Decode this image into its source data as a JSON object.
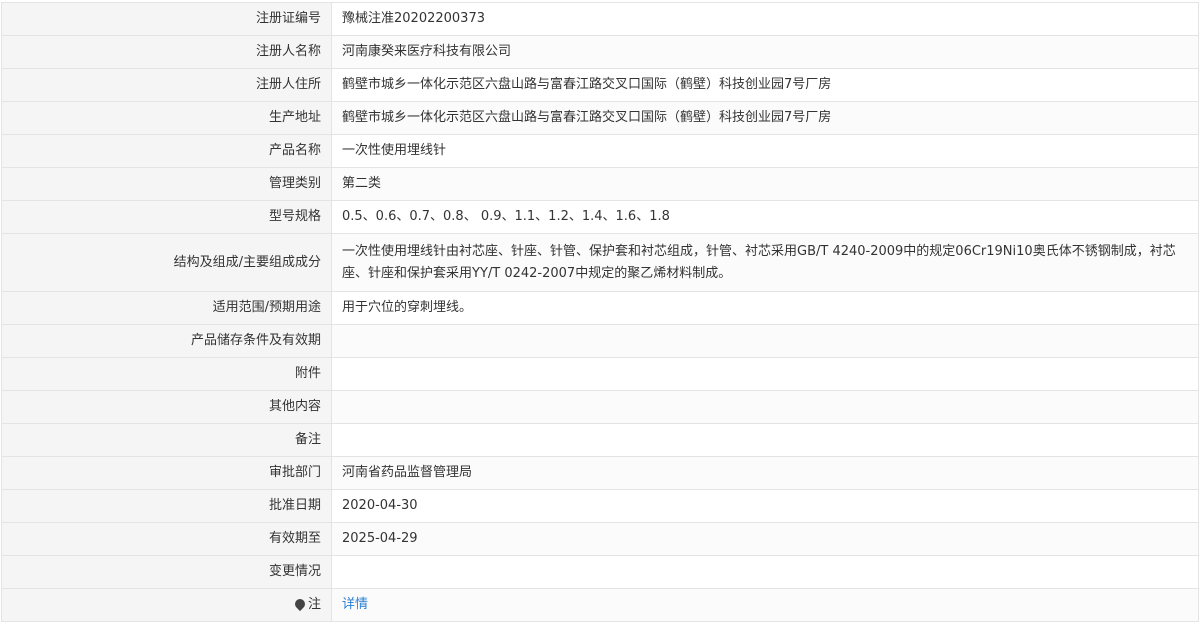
{
  "rows": [
    {
      "label": "注册证编号",
      "value": "豫械注准20202200373"
    },
    {
      "label": "注册人名称",
      "value": "河南康癸来医疗科技有限公司"
    },
    {
      "label": "注册人住所",
      "value": "鹤壁市城乡一体化示范区六盘山路与富春江路交叉口国际（鹤壁）科技创业园7号厂房"
    },
    {
      "label": "生产地址",
      "value": "鹤壁市城乡一体化示范区六盘山路与富春江路交叉口国际（鹤壁）科技创业园7号厂房"
    },
    {
      "label": "产品名称",
      "value": "一次性使用埋线针"
    },
    {
      "label": "管理类别",
      "value": "第二类"
    },
    {
      "label": "型号规格",
      "value": "0.5、0.6、0.7、0.8、 0.9、1.1、1.2、1.4、1.6、1.8"
    },
    {
      "label": "结构及组成/主要组成成分",
      "value": "一次性使用埋线针由衬芯座、针座、针管、保护套和衬芯组成，针管、衬芯采用GB/T 4240-2009中的规定06Cr19Ni10奥氏体不锈钢制成，衬芯座、针座和保护套采用YY/T 0242-2007中规定的聚乙烯材料制成。"
    },
    {
      "label": "适用范围/预期用途",
      "value": "用于穴位的穿刺埋线。"
    },
    {
      "label": "产品储存条件及有效期",
      "value": ""
    },
    {
      "label": "附件",
      "value": ""
    },
    {
      "label": "其他内容",
      "value": ""
    },
    {
      "label": "备注",
      "value": ""
    },
    {
      "label": "审批部门",
      "value": "河南省药品监督管理局"
    },
    {
      "label": "批准日期",
      "value": "2020-04-30"
    },
    {
      "label": "有效期至",
      "value": "2025-04-29"
    },
    {
      "label": "变更情况",
      "value": ""
    }
  ],
  "note": {
    "label": "注",
    "icon": "pin-icon",
    "link_text": "详情"
  }
}
